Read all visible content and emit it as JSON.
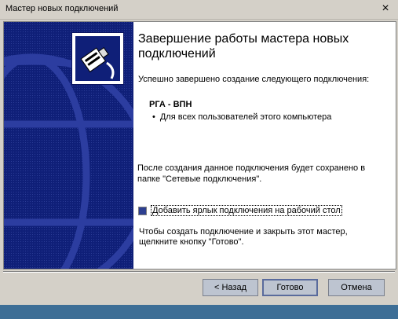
{
  "window": {
    "title": "Мастер новых подключений",
    "close_glyph": "×"
  },
  "banner": {
    "bg_color": "#0f1f78",
    "logo_icon": "network-cable-icon"
  },
  "content": {
    "heading": "Завершение работы мастера новых подключений",
    "intro": "Успешно завершено создание следующего подключения:",
    "connection_name": "РГА - ВПН",
    "bullet_glyph": "•",
    "bullet_text": "Для всех пользователей этого компьютера",
    "note": "После создания данное подключения будет сохранено в папке \"Сетевые подключения\".",
    "checkbox_label": "Добавить ярлык подключения на рабочий стол",
    "checkbox_checked": true,
    "finish_hint": "Чтобы создать подключение и закрыть этот мастер, щелкните кнопку \"Готово\"."
  },
  "buttons": {
    "back": "< Назад",
    "finish": "Готово",
    "cancel": "Отмена"
  }
}
